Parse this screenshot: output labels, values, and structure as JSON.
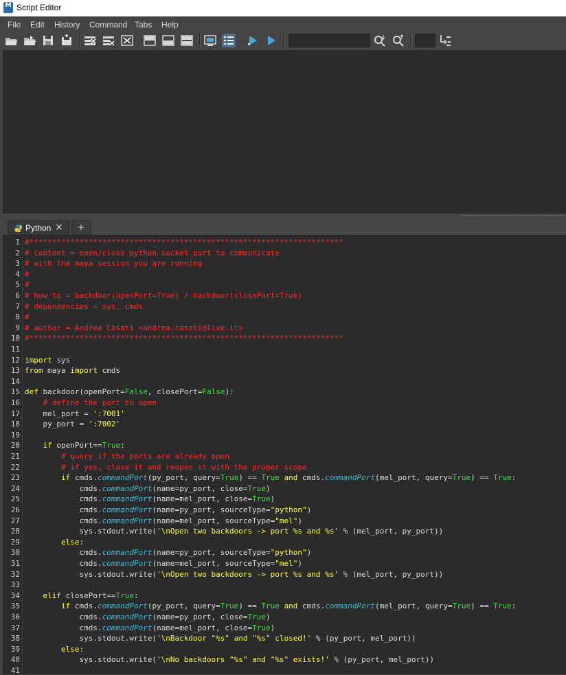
{
  "window": {
    "title": "Script Editor",
    "app_icon_label": "M"
  },
  "menu": [
    "File",
    "Edit",
    "History",
    "Command",
    "Tabs",
    "Help"
  ],
  "toolbar": {
    "buttons": [
      "open-script-icon",
      "source-script-icon",
      "save-script-icon",
      "save-script-shelf-icon",
      "clear-history-icon",
      "clear-input-icon",
      "clear-all-icon",
      "show-history-icon",
      "show-input-icon",
      "show-both-icon",
      "echo-all-commands-icon",
      "line-numbers-icon",
      "execute-all-icon",
      "execute-selected-icon",
      "search-down-icon",
      "search-up-icon",
      "goto-line-icon"
    ],
    "search_value": "",
    "goto_value": ""
  },
  "tabs": {
    "active": "Python",
    "add_label": "+"
  },
  "colors": {
    "comment": "#ff2a2a",
    "keyword": "#ffff33",
    "builtin": "#39e239",
    "string": "#ffff33",
    "function": "#3fb9d6"
  },
  "code_lines": [
    [
      [
        "c",
        "#*********************************************************************"
      ]
    ],
    [
      [
        "c",
        "# content = open/close python socket port to communicate"
      ]
    ],
    [
      [
        "c",
        "# with the maya session you are running"
      ]
    ],
    [
      [
        "c",
        "#"
      ]
    ],
    [
      [
        "c",
        "#"
      ]
    ],
    [
      [
        "c",
        "# how to = backdoor(openPort=True) / backdoor(closePort=True)"
      ]
    ],
    [
      [
        "c",
        "# dependencies = sys, cmds"
      ]
    ],
    [
      [
        "c",
        "#"
      ]
    ],
    [
      [
        "c",
        "# author = Andrea Casati <andrea.casati@live.it>"
      ]
    ],
    [
      [
        "c",
        "#*********************************************************************"
      ]
    ],
    [],
    [
      [
        "k",
        "import"
      ],
      [
        "n",
        " sys"
      ]
    ],
    [
      [
        "k",
        "from"
      ],
      [
        "n",
        " maya "
      ],
      [
        "k",
        "import"
      ],
      [
        "n",
        " cmds"
      ]
    ],
    [],
    [
      [
        "k",
        "def"
      ],
      [
        "n",
        " backdoor(openPort="
      ],
      [
        "b",
        "False"
      ],
      [
        "n",
        ", closePort="
      ],
      [
        "b",
        "False"
      ],
      [
        "n",
        "):"
      ]
    ],
    [
      [
        "n",
        "    "
      ],
      [
        "c",
        "# define the port to open"
      ]
    ],
    [
      [
        "n",
        "    mel_port = "
      ],
      [
        "s",
        "':7001'"
      ]
    ],
    [
      [
        "n",
        "    py_port = "
      ],
      [
        "s",
        "':7002'"
      ]
    ],
    [],
    [
      [
        "n",
        "    "
      ],
      [
        "k",
        "if"
      ],
      [
        "n",
        " openPort=="
      ],
      [
        "b",
        "True"
      ],
      [
        "n",
        ":"
      ]
    ],
    [
      [
        "n",
        "        "
      ],
      [
        "c",
        "# query if the ports are already open"
      ]
    ],
    [
      [
        "n",
        "        "
      ],
      [
        "c",
        "# if yes, close it and reopen it with the proper scope"
      ]
    ],
    [
      [
        "n",
        "        "
      ],
      [
        "k",
        "if"
      ],
      [
        "n",
        " cmds."
      ],
      [
        "f",
        "commandPort"
      ],
      [
        "n",
        "(py_port, query="
      ],
      [
        "b",
        "True"
      ],
      [
        "n",
        ") == "
      ],
      [
        "b",
        "True"
      ],
      [
        "n",
        " "
      ],
      [
        "k",
        "and"
      ],
      [
        "n",
        " cmds."
      ],
      [
        "f",
        "commandPort"
      ],
      [
        "n",
        "(mel_port, query="
      ],
      [
        "b",
        "True"
      ],
      [
        "n",
        ") == "
      ],
      [
        "b",
        "True"
      ],
      [
        "n",
        ":"
      ]
    ],
    [
      [
        "n",
        "            cmds."
      ],
      [
        "f",
        "commandPort"
      ],
      [
        "n",
        "(name=py_port, close="
      ],
      [
        "b",
        "True"
      ],
      [
        "n",
        ")"
      ]
    ],
    [
      [
        "n",
        "            cmds."
      ],
      [
        "f",
        "commandPort"
      ],
      [
        "n",
        "(name=mel_port, close="
      ],
      [
        "b",
        "True"
      ],
      [
        "n",
        ")"
      ]
    ],
    [
      [
        "n",
        "            cmds."
      ],
      [
        "f",
        "commandPort"
      ],
      [
        "n",
        "(name=py_port, sourceType="
      ],
      [
        "s",
        "\"python\""
      ],
      [
        "n",
        ")"
      ]
    ],
    [
      [
        "n",
        "            cmds."
      ],
      [
        "f",
        "commandPort"
      ],
      [
        "n",
        "(name=mel_port, sourceType="
      ],
      [
        "s",
        "\"mel\""
      ],
      [
        "n",
        ")"
      ]
    ],
    [
      [
        "n",
        "            sys.stdout.write("
      ],
      [
        "s",
        "'\\nOpen two backdoors -> port %s and %s'"
      ],
      [
        "n",
        " % (mel_port, py_port))"
      ]
    ],
    [
      [
        "n",
        "        "
      ],
      [
        "k",
        "else"
      ],
      [
        "n",
        ":"
      ]
    ],
    [
      [
        "n",
        "            cmds."
      ],
      [
        "f",
        "commandPort"
      ],
      [
        "n",
        "(name=py_port, sourceType="
      ],
      [
        "s",
        "\"python\""
      ],
      [
        "n",
        ")"
      ]
    ],
    [
      [
        "n",
        "            cmds."
      ],
      [
        "f",
        "commandPort"
      ],
      [
        "n",
        "(name=mel_port, sourceType="
      ],
      [
        "s",
        "\"mel\""
      ],
      [
        "n",
        ")"
      ]
    ],
    [
      [
        "n",
        "            sys.stdout.write("
      ],
      [
        "s",
        "'\\nOpen two backdoors -> port %s and %s'"
      ],
      [
        "n",
        " % (mel_port, py_port))"
      ]
    ],
    [],
    [
      [
        "n",
        "    "
      ],
      [
        "k",
        "elif"
      ],
      [
        "n",
        " closePort=="
      ],
      [
        "b",
        "True"
      ],
      [
        "n",
        ":"
      ]
    ],
    [
      [
        "n",
        "        "
      ],
      [
        "k",
        "if"
      ],
      [
        "n",
        " cmds."
      ],
      [
        "f",
        "commandPort"
      ],
      [
        "n",
        "(py_port, query="
      ],
      [
        "b",
        "True"
      ],
      [
        "n",
        ") == "
      ],
      [
        "b",
        "True"
      ],
      [
        "n",
        " "
      ],
      [
        "k",
        "and"
      ],
      [
        "n",
        " cmds."
      ],
      [
        "f",
        "commandPort"
      ],
      [
        "n",
        "(mel_port, query="
      ],
      [
        "b",
        "True"
      ],
      [
        "n",
        ") == "
      ],
      [
        "b",
        "True"
      ],
      [
        "n",
        ":"
      ]
    ],
    [
      [
        "n",
        "            cmds."
      ],
      [
        "f",
        "commandPort"
      ],
      [
        "n",
        "(name=py_port, close="
      ],
      [
        "b",
        "True"
      ],
      [
        "n",
        ")"
      ]
    ],
    [
      [
        "n",
        "            cmds."
      ],
      [
        "f",
        "commandPort"
      ],
      [
        "n",
        "(name=mel_port, close="
      ],
      [
        "b",
        "True"
      ],
      [
        "n",
        ")"
      ]
    ],
    [
      [
        "n",
        "            sys.stdout.write("
      ],
      [
        "s",
        "'\\nBackdoor \"%s\" and \"%s\" closed!'"
      ],
      [
        "n",
        " % (py_port, mel_port))"
      ]
    ],
    [
      [
        "n",
        "        "
      ],
      [
        "k",
        "else"
      ],
      [
        "n",
        ":"
      ]
    ],
    [
      [
        "n",
        "            sys.stdout.write("
      ],
      [
        "s",
        "'\\nNo backdoors \"%s\" and \"%s\" exists!'"
      ],
      [
        "n",
        " % (py_port, mel_port))"
      ]
    ],
    []
  ]
}
